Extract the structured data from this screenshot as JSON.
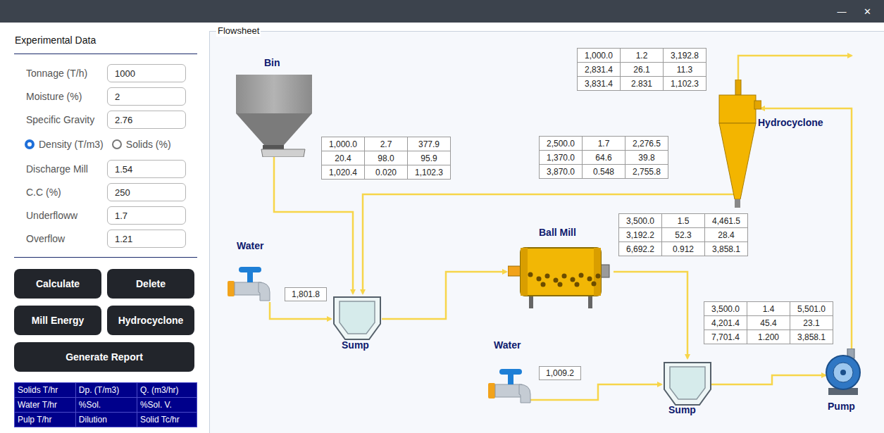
{
  "window": {
    "controls": [
      "—",
      "✕"
    ]
  },
  "sidebar": {
    "title": "Experimental Data",
    "fields_top": [
      {
        "label": "Tonnage (T/h)",
        "value": "1000"
      },
      {
        "label": "Moisture (%)",
        "value": "2"
      },
      {
        "label": "Specific Gravity",
        "value": "2.76"
      }
    ],
    "radios": [
      {
        "label": "Density (T/m3)",
        "selected": true
      },
      {
        "label": "Solids (%)",
        "selected": false
      }
    ],
    "fields_bottom": [
      {
        "label": "Discharge Mill",
        "value": "1.54"
      },
      {
        "label": "C.C (%)",
        "value": "250"
      },
      {
        "label": "Underfloww",
        "value": "1.7"
      },
      {
        "label": "Overflow",
        "value": "1.21"
      }
    ],
    "buttons": [
      {
        "label": "Calculate",
        "kind": "half"
      },
      {
        "label": "Delete",
        "kind": "half"
      },
      {
        "label": "Mill Energy",
        "kind": "half"
      },
      {
        "label": "Hydrocyclone",
        "kind": "half"
      },
      {
        "label": "Generate Report",
        "kind": "full"
      }
    ],
    "legend": [
      [
        "Solids T/hr",
        "Dp. (T/m3)",
        "Q. (m3/hr)"
      ],
      [
        "Water T/hr",
        "%Sol.",
        "%Sol. V."
      ],
      [
        "Pulp T/hr",
        "Dilution",
        "Solid Tc/hr"
      ]
    ]
  },
  "flowsheet": {
    "title": "Flowsheet",
    "equipment": [
      {
        "label": "Bin",
        "kind": "bin"
      },
      {
        "label": "Water",
        "kind": "tap"
      },
      {
        "label": "Sump",
        "kind": "sump"
      },
      {
        "label": "Ball Mill",
        "kind": "mill"
      },
      {
        "label": "Water",
        "kind": "tap"
      },
      {
        "label": "Sump",
        "kind": "sump"
      },
      {
        "label": "Hydrocyclone",
        "kind": "cyclone"
      },
      {
        "label": "Pump",
        "kind": "pump"
      }
    ],
    "streams": [
      {
        "rows": [
          [
            "1,000.0",
            "2.7",
            "377.9"
          ],
          [
            "20.4",
            "98.0",
            "95.9"
          ],
          [
            "1,020.4",
            "0.020",
            "1,102.3"
          ]
        ]
      },
      {
        "rows": [
          [
            "1,000.0",
            "1.2",
            "3,192.8"
          ],
          [
            "2,831.4",
            "26.1",
            "11.3"
          ],
          [
            "3,831.4",
            "2.831",
            "1,102.3"
          ]
        ]
      },
      {
        "rows": [
          [
            "2,500.0",
            "1.7",
            "2,276.5"
          ],
          [
            "1,370.0",
            "64.6",
            "39.8"
          ],
          [
            "3,870.0",
            "0.548",
            "2,755.8"
          ]
        ]
      },
      {
        "rows": [
          [
            "3,500.0",
            "1.5",
            "4,461.5"
          ],
          [
            "3,192.2",
            "52.3",
            "28.4"
          ],
          [
            "6,692.2",
            "0.912",
            "3,858.1"
          ]
        ]
      },
      {
        "rows": [
          [
            "3,500.0",
            "1.4",
            "5,501.0"
          ],
          [
            "4,201.4",
            "45.4",
            "23.1"
          ],
          [
            "7,701.4",
            "1.200",
            "3,858.1"
          ]
        ]
      }
    ],
    "water_additions": [
      {
        "value": "1,801.8"
      },
      {
        "value": "1,009.2"
      }
    ]
  }
}
